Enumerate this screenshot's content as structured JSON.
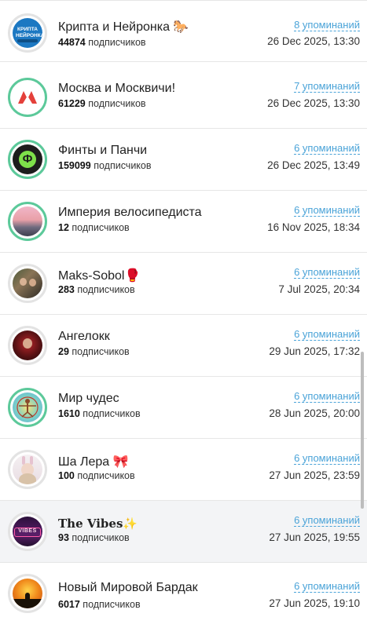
{
  "unit_label": "подписчиков",
  "channels": [
    {
      "name": "Крипта и Нейронка",
      "emoji": "🐎",
      "subscribers": "44874",
      "mentions": "8 упоминаний",
      "date": "26 Dec 2025, 13:30",
      "avatar_icon": "crypto-neural-logo-icon",
      "avatar_text": "КРИПТА НЕЙРОНКА"
    },
    {
      "name": "Москва и Москвичи!",
      "emoji": "",
      "subscribers": "61229",
      "mentions": "7 упоминаний",
      "date": "26 Dec 2025, 13:30",
      "avatar_icon": "moscow-metro-m-icon"
    },
    {
      "name": "Финты и Панчи",
      "emoji": "",
      "subscribers": "159099",
      "mentions": "6 упоминаний",
      "date": "26 Dec 2025, 13:49",
      "avatar_icon": "fp-logo-icon",
      "avatar_text": "Ф"
    },
    {
      "name": "Империя велосипедиста",
      "emoji": "",
      "subscribers": "12",
      "mentions": "6 упоминаний",
      "date": "16 Nov 2025, 18:34",
      "avatar_icon": "sunset-landscape-icon"
    },
    {
      "name": "Maks-Sobol",
      "emoji": "🥊",
      "subscribers": "283",
      "mentions": "6 упоминаний",
      "date": "7 Jul 2025, 20:34",
      "avatar_icon": "people-photo-icon"
    },
    {
      "name": "Ангелокк",
      "emoji": "",
      "subscribers": "29",
      "mentions": "6 упоминаний",
      "date": "29 Jun 2025, 17:32",
      "avatar_icon": "person-photo-icon"
    },
    {
      "name": "Мир чудес",
      "emoji": "",
      "subscribers": "1610",
      "mentions": "6 упоминаний",
      "date": "28 Jun 2025, 20:00",
      "avatar_icon": "vitruvian-man-icon"
    },
    {
      "name": "Ша Лера",
      "emoji": "🎀",
      "subscribers": "100",
      "mentions": "6 упоминаний",
      "date": "27 Jun 2025, 23:59",
      "avatar_icon": "bunny-girl-photo-icon"
    },
    {
      "name": "The Vibes",
      "emoji": "✨",
      "subscribers": "93",
      "mentions": "6 упоминаний",
      "date": "27 Jun 2025, 19:55",
      "avatar_icon": "vibes-neon-sign-icon",
      "avatar_text": "VIBES"
    },
    {
      "name": "Новый Мировой Бардак",
      "emoji": "",
      "subscribers": "6017",
      "mentions": "6 упоминаний",
      "date": "27 Jun 2025, 19:10",
      "avatar_icon": "orange-sunset-silhouette-icon"
    }
  ],
  "colors": {
    "accent_link": "#4aa3d8",
    "ring_green": "#5cc99a",
    "highlight_row": "#f3f4f6"
  }
}
